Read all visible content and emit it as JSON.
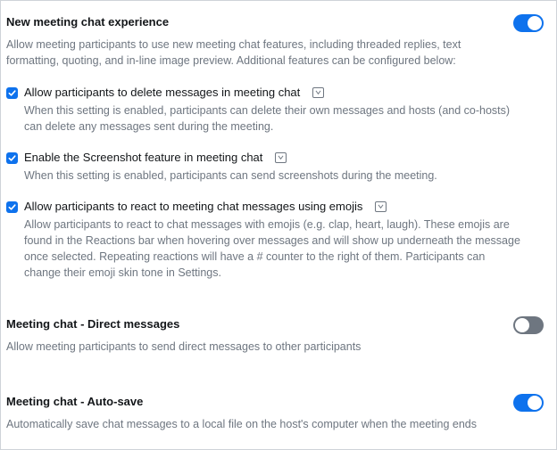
{
  "settings": {
    "chat_experience": {
      "title": "New meeting chat experience",
      "description": "Allow meeting participants to use new meeting chat features, including threaded replies, text formatting, quoting, and in-line image preview. Additional features can be configured below:",
      "enabled": true,
      "options": [
        {
          "label": "Allow participants to delete messages in meeting chat",
          "checked": true,
          "description": "When this setting is enabled, participants can delete their own messages and hosts (and co-hosts) can delete any messages sent during the meeting."
        },
        {
          "label": "Enable the Screenshot feature in meeting chat",
          "checked": true,
          "description": "When this setting is enabled, participants can send screenshots during the meeting."
        },
        {
          "label": "Allow participants to react to meeting chat messages using emojis",
          "checked": true,
          "description": "Allow participants to react to chat messages with emojis (e.g. clap, heart, laugh). These emojis are found in the Reactions bar when hovering over messages and will show up underneath the message once selected. Repeating reactions will have a # counter to the right of them. Participants can change their emoji skin tone in Settings."
        }
      ]
    },
    "direct_messages": {
      "title": "Meeting chat - Direct messages",
      "description": "Allow meeting participants to send direct messages to other participants",
      "enabled": false
    },
    "auto_save": {
      "title": "Meeting chat - Auto-save",
      "description": "Automatically save chat messages to a local file on the host's computer when the meeting ends",
      "enabled": true
    }
  },
  "colors": {
    "accent": "#0e72ed",
    "toggle_off": "#6e7680",
    "muted_text": "#6e7680",
    "title_text": "#131619"
  },
  "icons": {
    "checkbox": "check-icon",
    "info": "info-icon"
  }
}
